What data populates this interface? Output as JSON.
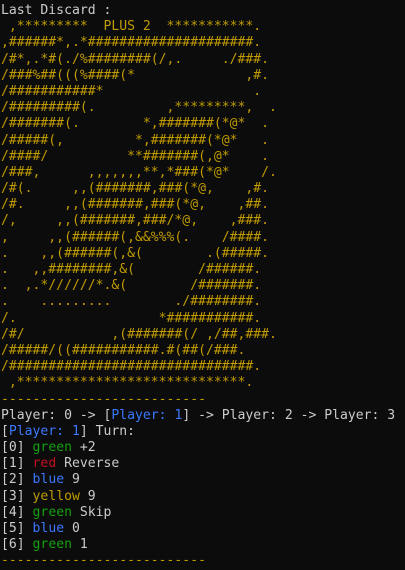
{
  "header": {
    "last_discard_label": "Last Discard :"
  },
  "card_art": {
    "color": "#c19c00",
    "lines": [
      " ,*********  PLUS 2  ***********.",
      ",######*,.*#####################.",
      "/#*,.*#(./%########(/,.     ./###.",
      "/###%##(((%####(*              ,#.",
      "/###########*                   .",
      "/#########(.         ,*********,  .",
      "/#######(.        *,#######(*@*  .",
      "/#####(,         *,#######(*@*   .",
      "/####/          **#######(,@*    .",
      "/###,      ,,,,,,,**,*###(*@*    /.",
      "/#(.     ,,(#######,###(*@,    ,#.",
      "/#.     ,,(#######,###(*@,    ,##.",
      "/,     ,,(#######,###/*@,    ,###.",
      ",     ,,(######(,&&%%%(.    /####.",
      ".    ,,(######(,&(        .(#####.",
      ".   ,,########,&(        /######.",
      ".  ,.*//////*.&(        /#######.",
      ".    .........        ./########.",
      "/.                  *###########.",
      "/#/           ,(#######(/ ,/##,###.",
      "/#####/((###########.#(##(/###.",
      "/###############################.",
      " ,*****************************."
    ]
  },
  "divider": "--------------------------",
  "turn_order": {
    "prefix": "Player: 0 -> ",
    "current_open": "[",
    "current": "Player: 1",
    "current_close": "]",
    "suffix": " -> Player: 2 -> Player: 3"
  },
  "turn_prompt": {
    "open": "[",
    "player": "Player: 1",
    "close": "] Turn:"
  },
  "hand": [
    {
      "index": "[0]",
      "color_name": "green",
      "value": "+2",
      "hex": "#13a10e"
    },
    {
      "index": "[1]",
      "color_name": "red",
      "value": "Reverse",
      "hex": "#c50f1f"
    },
    {
      "index": "[2]",
      "color_name": "blue",
      "value": "9",
      "hex": "#3b78ff"
    },
    {
      "index": "[3]",
      "color_name": "yellow",
      "value": "9",
      "hex": "#c19c00"
    },
    {
      "index": "[4]",
      "color_name": "green",
      "value": "Skip",
      "hex": "#13a10e"
    },
    {
      "index": "[5]",
      "color_name": "blue",
      "value": "0",
      "hex": "#3b78ff"
    },
    {
      "index": "[6]",
      "color_name": "green",
      "value": "1",
      "hex": "#13a10e"
    }
  ],
  "colors": {
    "background": "#0c0c0c",
    "text": "#cccccc",
    "highlight_player": "#3b78ff",
    "divider": "#c19c00"
  }
}
